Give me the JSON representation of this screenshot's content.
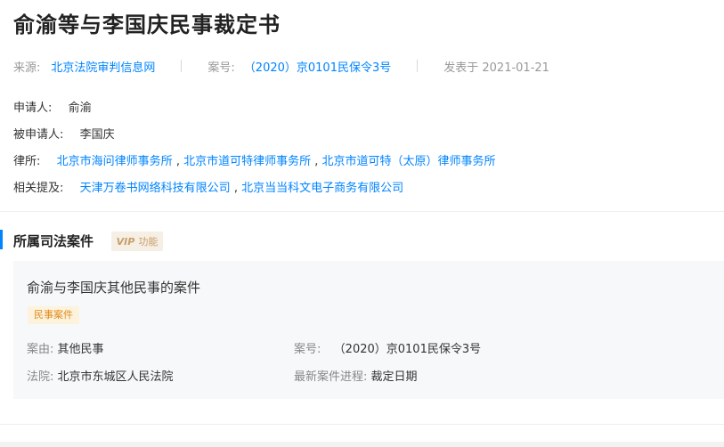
{
  "page": {
    "title": "俞渝等与李国庆民事裁定书"
  },
  "meta": {
    "source_label": "来源:",
    "source_value": "北京法院审判信息网",
    "case_no_label": "案号:",
    "case_no_value": "（2020）京0101民保令3号",
    "published": "发表于 2021-01-21"
  },
  "parties": {
    "applicant_label": "申请人:",
    "applicant_value": "俞渝",
    "respondent_label": "被申请人:",
    "respondent_value": "李国庆",
    "law_firm_label": "律所:",
    "law_firms": [
      "北京市海问律师事务所",
      "北京市道可特律师事务所",
      "北京市道可特（太原）律师事务所"
    ],
    "mentions_label": "相关提及:",
    "mentions": [
      "天津万卷书网络科技有限公司",
      "北京当当科文电子商务有限公司"
    ],
    "separator": ","
  },
  "section": {
    "title": "所属司法案件",
    "vip_text": "VIP",
    "vip_suffix": "功能"
  },
  "case_card": {
    "title": "俞渝与李国庆其他民事的案件",
    "tag": "民事案件",
    "cause_label": "案由:",
    "cause_value": "其他民事",
    "case_no_label": "案号:",
    "case_no_value": "（2020）京0101民保令3号",
    "court_label": "法院:",
    "court_value": "北京市东城区人民法院",
    "progress_label": "最新案件进程:",
    "progress_value": "裁定日期"
  },
  "colors": {
    "link": "#0084ff",
    "accent_bar": "#0084ff",
    "tag_bg": "#fdf3dc",
    "tag_text": "#e08a1e",
    "vip": "#c8a06a"
  }
}
